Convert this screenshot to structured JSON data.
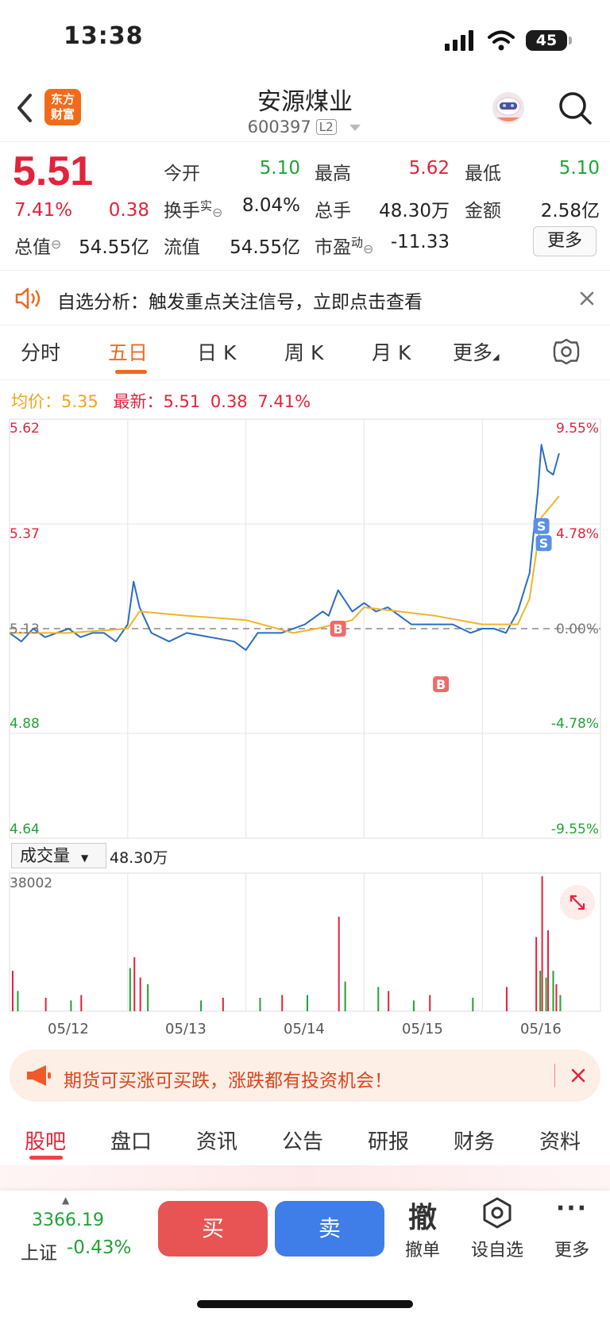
{
  "status": {
    "time": "13:38",
    "battery": "45"
  },
  "header": {
    "logo_line1": "东方",
    "logo_line2": "财富",
    "name": "安源煤业",
    "code": "600397",
    "level": "L2"
  },
  "quote": {
    "price": "5.51",
    "change_pct": "7.41%",
    "change": "0.38",
    "open_label": "今开",
    "open": "5.10",
    "high_label": "最高",
    "high": "5.62",
    "low_label": "最低",
    "low": "5.10",
    "turnover_label": "换手",
    "turnover_sup": "实",
    "turnover": "8.04%",
    "volume_label": "总手",
    "volume": "48.30万",
    "amount_label": "金额",
    "amount": "2.58亿",
    "mktcap_label": "总值",
    "mktcap": "54.55亿",
    "float_label": "流值",
    "float": "54.55亿",
    "pe_label": "市盈",
    "pe_sup": "动",
    "pe": "-11.33",
    "more": "更多"
  },
  "alert": {
    "text": "自选分析：触发重点关注信号，立即点击查看"
  },
  "tabs": [
    "分时",
    "五日",
    "日 K",
    "周 K",
    "月 K",
    "更多"
  ],
  "chart_info": {
    "avg_label": "均价：",
    "avg": "5.35",
    "latest_label": "最新：",
    "latest": "5.51",
    "latest_change": "0.38",
    "latest_pct": "7.41%"
  },
  "chart_data": {
    "type": "line",
    "title": "",
    "x_labels": [
      "05/12",
      "05/13",
      "05/14",
      "05/15",
      "05/16"
    ],
    "y_left_ticks": [
      "5.62",
      "5.37",
      "5.13",
      "4.88",
      "4.64"
    ],
    "y_right_ticks": [
      "9.55%",
      "4.78%",
      "0.00%",
      "-4.78%",
      "-9.55%"
    ],
    "ylim": [
      4.64,
      5.62
    ],
    "prev_close": 5.13,
    "series": [
      {
        "name": "",
        "color": "#2b6cc4",
        "x": [
          0,
          0.1,
          0.2,
          0.3,
          0.4,
          0.5,
          0.6,
          0.7,
          0.8,
          0.9,
          1,
          1.05,
          1.1,
          1.2,
          1.35,
          1.5,
          1.7,
          1.9,
          2,
          2.1,
          2.3,
          2.5,
          2.65,
          2.7,
          2.78,
          2.9,
          3,
          3.1,
          3.2,
          3.4,
          3.6,
          3.75,
          3.9,
          4,
          4.1,
          4.2,
          4.3,
          4.4,
          4.47,
          4.5,
          4.55,
          4.6,
          4.65
        ],
        "y": [
          5.12,
          5.1,
          5.13,
          5.11,
          5.12,
          5.13,
          5.11,
          5.12,
          5.12,
          5.1,
          5.14,
          5.24,
          5.18,
          5.12,
          5.1,
          5.12,
          5.11,
          5.1,
          5.08,
          5.12,
          5.12,
          5.14,
          5.17,
          5.16,
          5.22,
          5.17,
          5.19,
          5.17,
          5.18,
          5.14,
          5.14,
          5.14,
          5.12,
          5.13,
          5.13,
          5.12,
          5.17,
          5.26,
          5.45,
          5.56,
          5.5,
          5.49,
          5.54
        ]
      },
      {
        "name": "",
        "color": "#f0b429",
        "x": [
          0,
          0.5,
          1,
          1.1,
          1.5,
          2,
          2.4,
          2.6,
          2.9,
          3,
          3.3,
          3.6,
          4,
          4.3,
          4.4,
          4.5,
          4.65
        ],
        "y": [
          5.12,
          5.12,
          5.13,
          5.17,
          5.16,
          5.15,
          5.12,
          5.13,
          5.15,
          5.18,
          5.17,
          5.16,
          5.14,
          5.14,
          5.2,
          5.39,
          5.44
        ]
      }
    ],
    "markers": [
      {
        "label": "B",
        "x": 2.78,
        "y": 5.13
      },
      {
        "label": "B",
        "x": 3.65,
        "y": 5.0
      },
      {
        "label": "S",
        "x": 4.5,
        "y": 5.37
      },
      {
        "label": "S",
        "x": 4.52,
        "y": 5.33
      }
    ],
    "volume": {
      "label": "成交量",
      "total": "48.30万",
      "max_tick": "38002",
      "max": 38002,
      "red_bars": [
        [
          0.02,
          0.3
        ],
        [
          0.3,
          0.1
        ],
        [
          0.6,
          0.12
        ],
        [
          1.05,
          0.4
        ],
        [
          1.1,
          0.25
        ],
        [
          1.8,
          0.1
        ],
        [
          2.3,
          0.12
        ],
        [
          2.78,
          0.7
        ],
        [
          3.2,
          0.15
        ],
        [
          3.55,
          0.12
        ],
        [
          4.2,
          0.18
        ],
        [
          4.45,
          0.55
        ],
        [
          4.5,
          1.0
        ],
        [
          4.55,
          0.6
        ],
        [
          4.62,
          0.2
        ]
      ],
      "green_bars": [
        [
          0.05,
          0.15
        ],
        [
          0.5,
          0.08
        ],
        [
          1.0,
          0.32
        ],
        [
          1.15,
          0.2
        ],
        [
          1.6,
          0.08
        ],
        [
          2.1,
          0.1
        ],
        [
          2.5,
          0.12
        ],
        [
          2.82,
          0.22
        ],
        [
          3.1,
          0.18
        ],
        [
          3.4,
          0.08
        ],
        [
          3.9,
          0.1
        ],
        [
          4.47,
          0.3
        ],
        [
          4.52,
          0.25
        ],
        [
          4.58,
          0.3
        ],
        [
          4.64,
          0.12
        ]
      ]
    }
  },
  "promo": {
    "text": "期货可买涨可买跌，涨跌都有投资机会！"
  },
  "bottom_tabs": [
    "股吧",
    "盘口",
    "资讯",
    "公告",
    "研报",
    "财务",
    "资料"
  ],
  "bottom_bar": {
    "index_value": "3366.19",
    "index_name": "上证",
    "index_change": "-0.43%",
    "buy": "买",
    "sell": "卖",
    "cancel_icon": "撤",
    "cancel": "撤单",
    "watchlist": "设自选",
    "more": "更多"
  }
}
